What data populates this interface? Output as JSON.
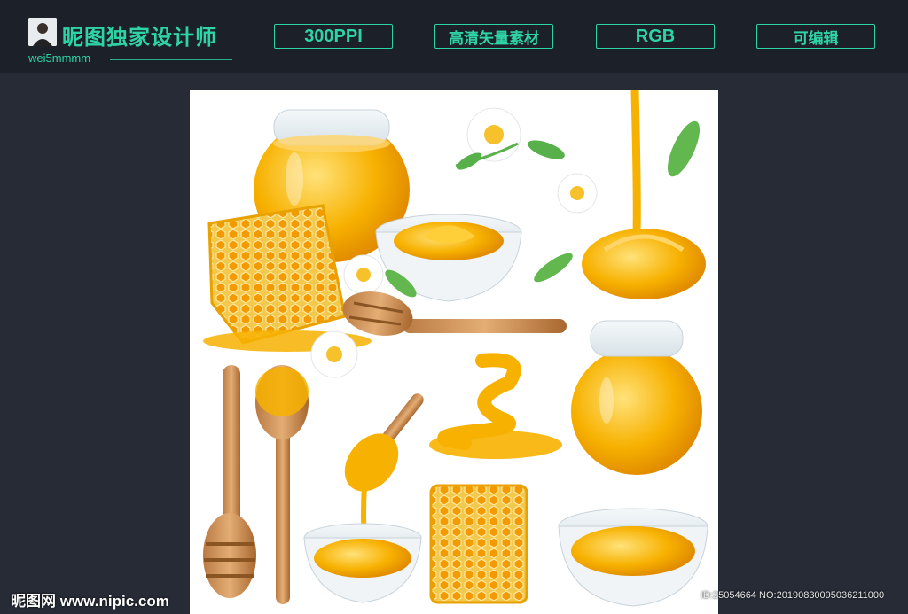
{
  "header": {
    "title": "昵图独家设计师",
    "username": "wei5mmmm",
    "badges": [
      "300PPI",
      "高清矢量素材",
      "RGB",
      "可编辑"
    ]
  },
  "watermark": {
    "site": "昵图网 www.nipic.com",
    "id": "ID:25054664 NO:20190830095036211000"
  },
  "colors": {
    "accent": "#2ed3a6",
    "header_bg": "#1b2029",
    "page_bg": "#262b36",
    "honey": "#f5a300",
    "wood": "#c98b52"
  },
  "illustrations": [
    "honey-jar-icon",
    "honey-bowl-icon",
    "honeycomb-icon",
    "honey-dipper-icon",
    "chamomile-flower-icon",
    "green-leaf-icon",
    "honey-drip-puddle-icon",
    "wooden-spoon-icon"
  ]
}
